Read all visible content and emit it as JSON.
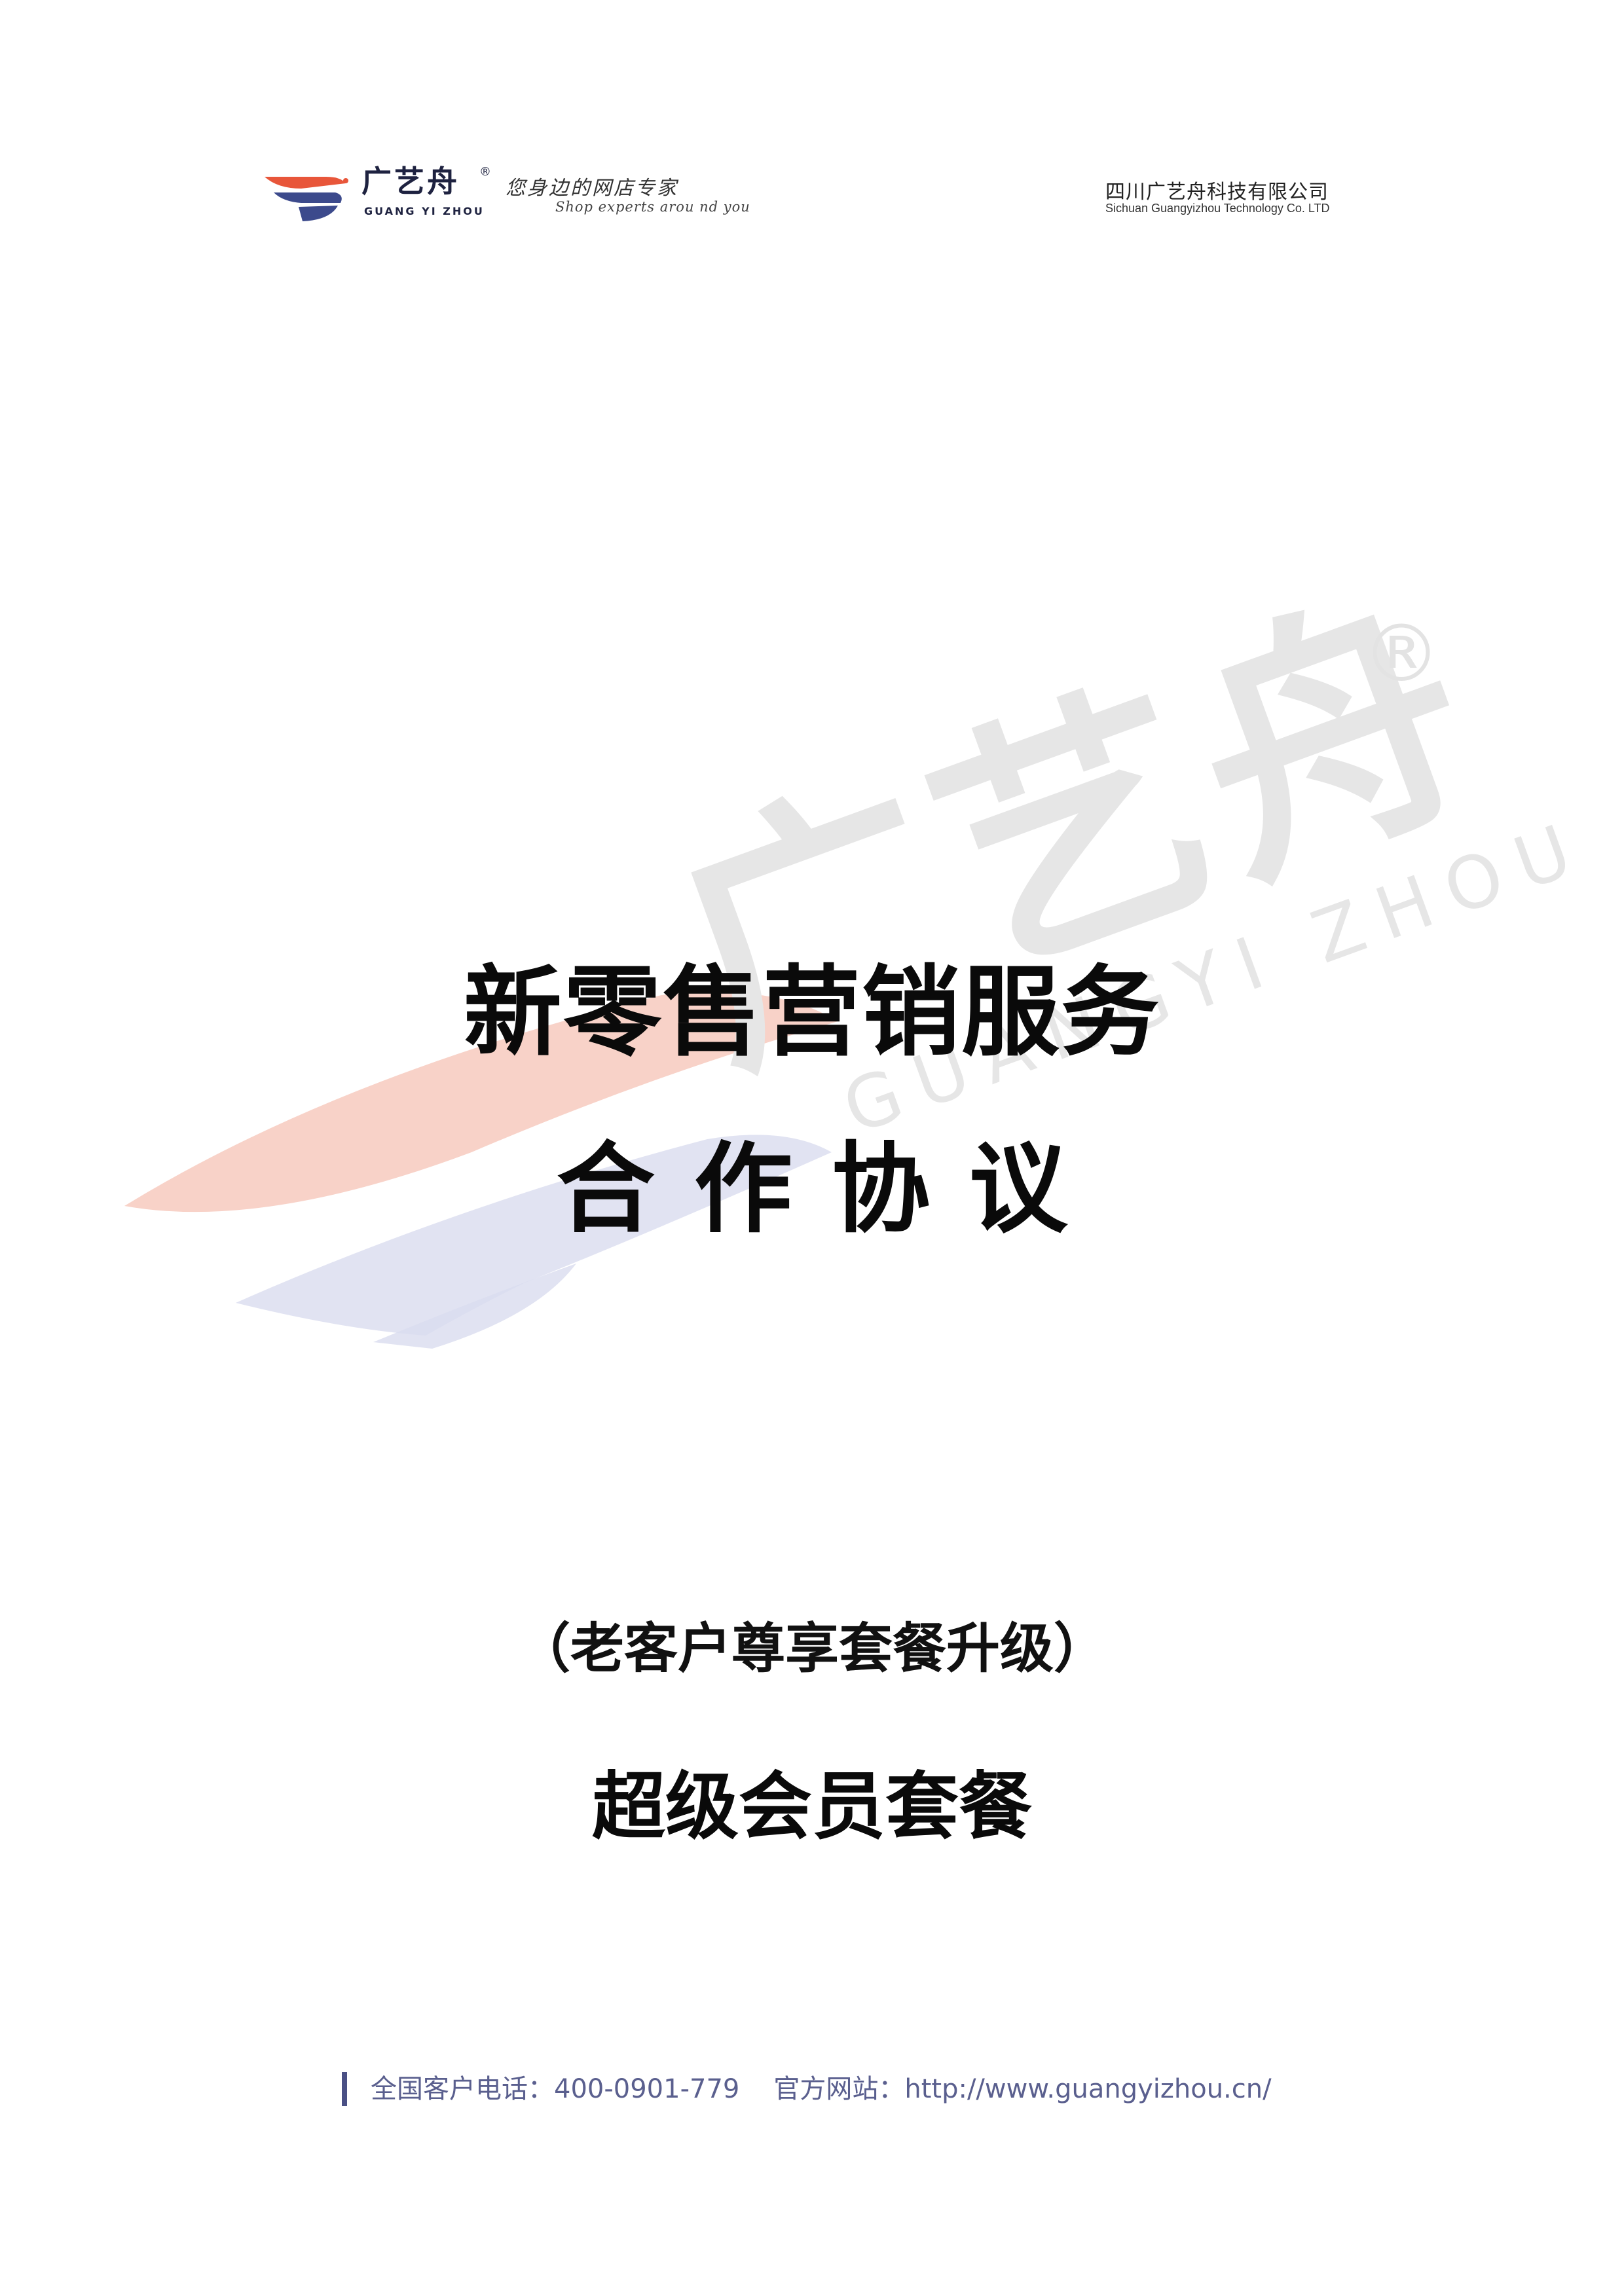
{
  "header": {
    "logo_cn": "广艺舟",
    "logo_reg": "®",
    "logo_en": "GUANG YI ZHOU",
    "slogan_cn": "您身边的网店专家",
    "slogan_en": "Shop experts arou  nd you",
    "company_cn": "四川广艺舟科技有限公司",
    "company_en": "Sichuan Guangyizhou Technology Co. LTD"
  },
  "watermark": {
    "text_cn": "广艺舟",
    "text_en": "GUANGYI ZHOU",
    "reg": "®"
  },
  "document": {
    "title_line1": "新零售营销服务",
    "title_line2": "合作协议",
    "subtitle": "（老客户尊享套餐升级）",
    "package_name": "超级会员套餐"
  },
  "footer": {
    "hotline_label": "全国客户电话：",
    "hotline": "400-0901-779",
    "website_label": "官方网站：",
    "website": "http://www.guangyizhou.cn/"
  },
  "colors": {
    "brand_red": "#e8563a",
    "brand_navy": "#3c4a8c",
    "watermark_gray": "#e4e4e4",
    "footer_text": "#5a5f8e"
  }
}
